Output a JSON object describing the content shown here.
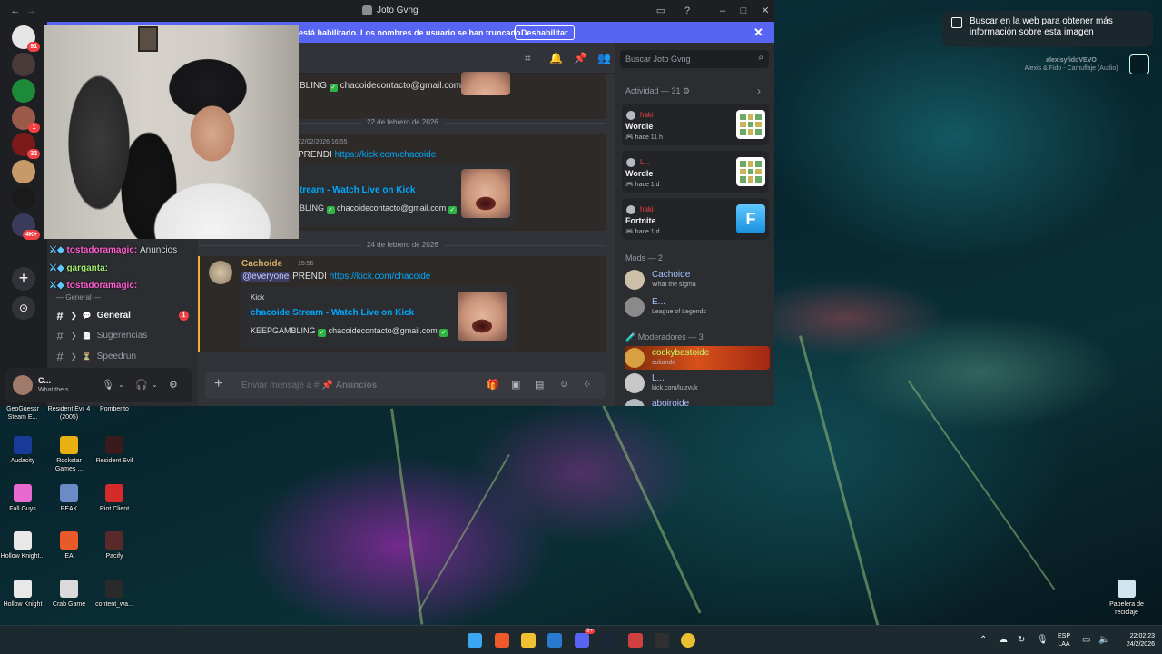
{
  "window": {
    "title": "Joto Gvng",
    "banner_text": "está habilitado. Los nombres de usuario se han truncado.",
    "banner_button": "Deshabilitar",
    "close_glyph": "✕",
    "back_glyph": "←",
    "forward_glyph": "→"
  },
  "servers": [
    {
      "name": "server-1",
      "badge": "91",
      "color": "#e6e6e6"
    },
    {
      "name": "server-2",
      "badge": "",
      "color": "#4a3a3a"
    },
    {
      "name": "server-3",
      "badge": "",
      "color": "#1d8a3a"
    },
    {
      "name": "server-4",
      "badge": "1",
      "color": "#9a5a4a"
    },
    {
      "name": "server-5",
      "badge": "32",
      "color": "#7a1a1a"
    },
    {
      "name": "server-6",
      "badge": "",
      "color": "#c89a6a"
    },
    {
      "name": "server-7",
      "badge": "",
      "color": "#1a1a1a"
    },
    {
      "name": "server-8",
      "badge": "4K+",
      "color": "#3a3a5a"
    }
  ],
  "chat_overlay": [
    {
      "name": "tostadoramagic:",
      "text": "Anuncios"
    },
    {
      "name": "garganta:",
      "text": ""
    },
    {
      "name": "tostadoramagic:",
      "text": ""
    }
  ],
  "channels": {
    "category": "General",
    "items": [
      {
        "label": "General",
        "unread": "1",
        "active": true
      },
      {
        "label": "Sugerencias",
        "unread": "",
        "active": false
      },
      {
        "label": "Speedrun",
        "unread": "",
        "active": false
      }
    ]
  },
  "user_panel": {
    "name": "C...",
    "status": "What the s"
  },
  "messages": {
    "top_text": "BLING",
    "top_contact": "chacoidecontacto@gmail.com",
    "date_1": "22 de febrero de 2026",
    "msg1_time": "22/02/2026 16:55",
    "msg1_prefix": "PRENDI",
    "msg1_link": "https://kick.com/chacoide",
    "embed1_title": "tream - Watch Live on Kick",
    "embed1_desc": "BLING",
    "embed1_contact": "chacoidecontacto@gmail.com",
    "date_2": "24 de febrero de 2026",
    "msg2_author": "Cachoide",
    "msg2_time": "15:56",
    "msg2_mention": "@everyone",
    "msg2_prefix": "PRENDI",
    "msg2_link": "https://kick.com/chacoide",
    "embed2_provider": "Kick",
    "embed2_title": "chacoide Stream - Watch Live on Kick",
    "embed2_desc": "KEEPGAMBLING",
    "embed2_contact": "chacoidecontacto@gmail.com"
  },
  "composer": {
    "placeholder": "Enviar mensaje a #",
    "channel": "Anuncios"
  },
  "search": {
    "placeholder": "Buscar Joto Gvng"
  },
  "members": {
    "activity_title": "Actividad — 31",
    "activities": [
      {
        "user": "haki",
        "game": "Wordle",
        "time": "hace 11 h",
        "kind": "wordle"
      },
      {
        "user": "L...",
        "game": "Wordle",
        "time": "hace 1 d",
        "kind": "wordle"
      },
      {
        "user": "haki",
        "game": "Fortnite",
        "time": "hace 1 d",
        "kind": "fortnite"
      }
    ],
    "mods_title": "Mods — 2",
    "mods": [
      {
        "name": "Cachoide",
        "status": "What the sigma"
      },
      {
        "name": "E...",
        "status": "League of Legends"
      }
    ],
    "moderators_title": "Moderadores — 3",
    "moderators": [
      {
        "name": "cockybastoide",
        "status": "culiando",
        "highlight": true
      },
      {
        "name": "L...",
        "status": "kick.com/luizvuk",
        "highlight": false
      },
      {
        "name": "aboiroide",
        "status": "",
        "highlight": false
      }
    ]
  },
  "lens": {
    "popup_text": "Buscar en la web para obtener más información sobre esta imagen",
    "watermark_name": "alexisyfidoVEVO",
    "watermark_song": "Alexis & Fido - Camuflaje (Audio)"
  },
  "desktop_icons": [
    {
      "label": "GeoGuessr Steam E...",
      "color": "#3a6a3a"
    },
    {
      "label": "Resident Evil 4 (2005)",
      "color": "#5a4a2a"
    },
    {
      "label": "Pomberito",
      "color": "#2a2a2a"
    },
    {
      "label": "Audacity",
      "color": "#1a3a9a"
    },
    {
      "label": "Rockstar Games ...",
      "color": "#e8b010"
    },
    {
      "label": "Resident Evil",
      "color": "#3a1a1a"
    },
    {
      "label": "Fall Guys",
      "color": "#e86ad0"
    },
    {
      "label": "PEAK",
      "color": "#6a8ac8"
    },
    {
      "label": "Riot Client",
      "color": "#d42a2a"
    },
    {
      "label": "Hollow Knight...",
      "color": "#e8e8e8"
    },
    {
      "label": "EA",
      "color": "#e85a2a"
    },
    {
      "label": "Pacify",
      "color": "#5a2a2a"
    },
    {
      "label": "Hollow Knight",
      "color": "#e8e8e8"
    },
    {
      "label": "Crab Game",
      "color": "#dadada"
    },
    {
      "label": "content_wa...",
      "color": "#2a2a2a"
    },
    {
      "label": "Papelera de reciclaje",
      "color": "#cfe6f0"
    }
  ],
  "taskbar": {
    "lang_top": "ESP",
    "lang_bottom": "LAA",
    "time": "22:02:23",
    "date": "24/2/2026",
    "apps": [
      "windows",
      "brave",
      "file-explorer",
      "bing",
      "discord",
      "steam",
      "calendar",
      "obs",
      "chrome"
    ],
    "discord_badge": "9+"
  }
}
